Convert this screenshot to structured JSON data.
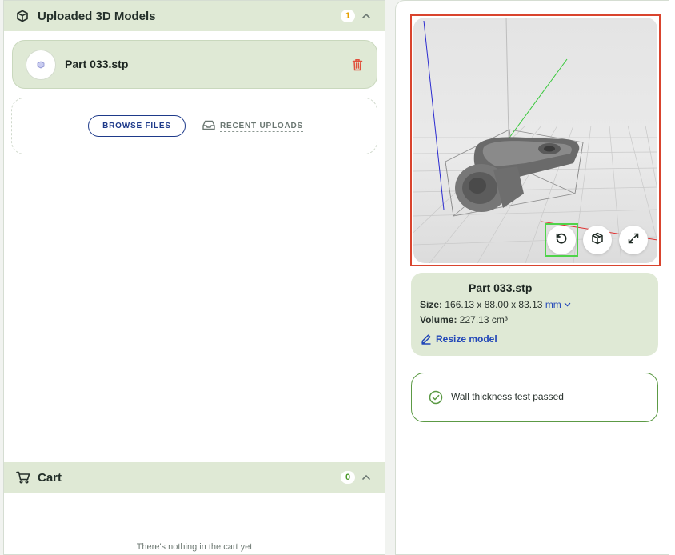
{
  "uploaded": {
    "title": "Uploaded 3D Models",
    "count": "1",
    "model": {
      "name": "Part 033.stp"
    },
    "browse_label": "BROWSE FILES",
    "recent_label": "RECENT UPLOADS"
  },
  "cart": {
    "title": "Cart",
    "count": "0",
    "empty_text": "There's nothing in the cart yet"
  },
  "viewer": {
    "controls": [
      "reset-view-icon",
      "box-view-icon",
      "expand-icon"
    ]
  },
  "model_info": {
    "name": "Part 033.stp",
    "size_label": "Size:",
    "size_value": "166.13 x 88.00 x 83.13",
    "size_unit": "mm",
    "volume_label": "Volume:",
    "volume_value": "227.13 cm³",
    "resize_label": "Resize model"
  },
  "wall_check": {
    "text": "Wall thickness test passed",
    "status_color": "#5c9a45"
  },
  "colors": {
    "panel_green": "#dfe9d5",
    "accent_blue": "#1e3a8a",
    "link_blue": "#2247b8",
    "delete_red": "#e0503c",
    "highlight_red": "#d9442e",
    "highlight_green": "#4fd34a",
    "count_orange": "#e5a000",
    "count_green": "#4d9a2a"
  }
}
